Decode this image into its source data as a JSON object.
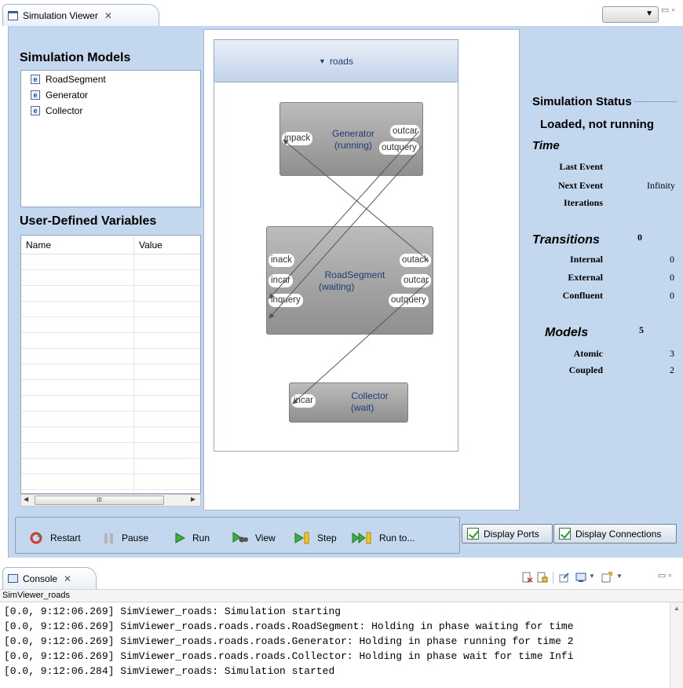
{
  "view_tab": {
    "title": "Simulation Viewer",
    "close": "✕"
  },
  "left": {
    "models_title": "Simulation Models",
    "models": [
      "RoadSegment",
      "Generator",
      "Collector"
    ],
    "vars_title": "User-Defined Variables",
    "vars_columns": [
      "Name",
      "Value"
    ],
    "scroll_thumb": "III"
  },
  "canvas": {
    "coupled_name": "roads",
    "nodes": {
      "generator": {
        "name": "Generator",
        "state": "(running)",
        "ports": {
          "inpack": "inpack",
          "outcar": "outcar",
          "outquery": "outquery"
        }
      },
      "roadsegment": {
        "name": "RoadSegment",
        "state": "(waiting)",
        "ports": {
          "inack": "inack",
          "incar": "incar",
          "inquery": "inquery",
          "outack": "outack",
          "outcar": "outcar",
          "outquery": "outquery"
        }
      },
      "collector": {
        "name": "Collector",
        "state": "(wait)",
        "ports": {
          "incar": "incar"
        }
      }
    }
  },
  "status": {
    "title": "Simulation Status",
    "state": "Loaded, not running",
    "time_header": "Time",
    "last_event_label": "Last Event",
    "last_event_value": "",
    "next_event_label": "Next Event",
    "next_event_value": "Infinity",
    "iterations_label": "Iterations",
    "iterations_value": "",
    "transitions_header": "Transitions",
    "transitions_total": "0",
    "internal_label": "Internal",
    "internal_value": "0",
    "external_label": "External",
    "external_value": "0",
    "confluent_label": "Confluent",
    "confluent_value": "0",
    "models_header": "Models",
    "models_total": "5",
    "atomic_label": "Atomic",
    "atomic_value": "3",
    "coupled_label": "Coupled",
    "coupled_value": "2"
  },
  "controls": {
    "restart": "Restart",
    "pause": "Pause",
    "run": "Run",
    "view": "View",
    "step": "Step",
    "run_to": "Run to...",
    "display_ports": "Display Ports",
    "display_connections": "Display Connections"
  },
  "console": {
    "tab_title": "Console",
    "close": "✕",
    "name": "SimViewer_roads",
    "lines": [
      "[0.0, 9:12:06.269] SimViewer_roads: Simulation starting",
      "[0.0, 9:12:06.269] SimViewer_roads.roads.roads.RoadSegment: Holding in phase waiting for time",
      "[0.0, 9:12:06.269] SimViewer_roads.roads.roads.Generator: Holding in phase running for time 2",
      "[0.0, 9:12:06.269] SimViewer_roads.roads.roads.Collector: Holding in phase wait for time Infi",
      "[0.0, 9:12:06.284] SimViewer_roads: Simulation started"
    ]
  }
}
